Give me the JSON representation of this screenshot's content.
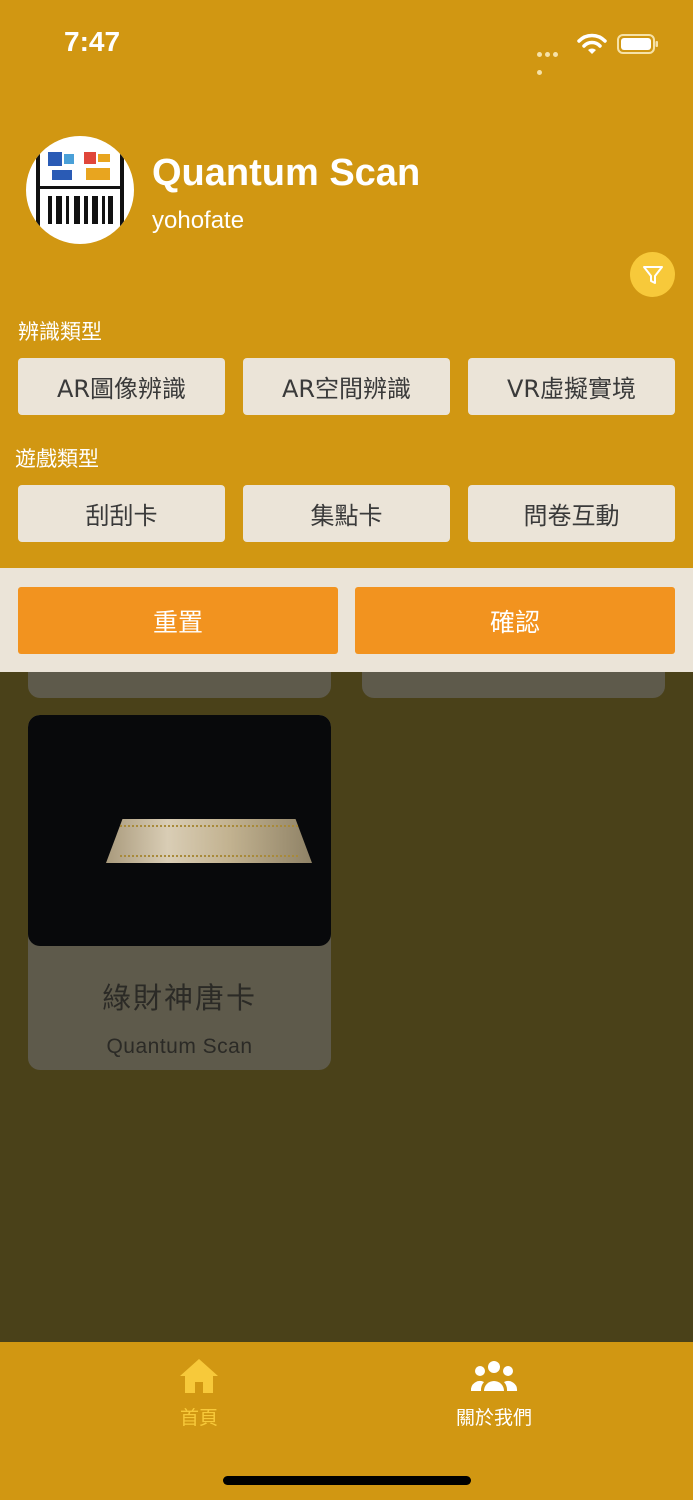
{
  "status_bar": {
    "time": "7:47"
  },
  "header": {
    "title": "Quantum Scan",
    "username": "yohofate"
  },
  "filter": {
    "recognition_label": "辨識類型",
    "recognition_options": [
      "AR圖像辨識",
      "AR空間辨識",
      "VR虛擬實境"
    ],
    "game_label": "遊戲類型",
    "game_options": [
      "刮刮卡",
      "集點卡",
      "問卷互動"
    ],
    "reset_label": "重置",
    "confirm_label": "確認"
  },
  "cards": [
    {
      "title": "綠財神唐卡",
      "subtitle": "Quantum Scan"
    }
  ],
  "tabs": [
    {
      "label": "首頁",
      "icon": "home-icon",
      "active": true
    },
    {
      "label": "關於我們",
      "icon": "users-icon",
      "active": false
    }
  ],
  "colors": {
    "header_bg": "#d19712",
    "action_orange": "#f2931f",
    "chip_bg": "#ebe4d8",
    "filter_icon_bg": "#f7c93a",
    "active_tab": "#f7c93a"
  }
}
